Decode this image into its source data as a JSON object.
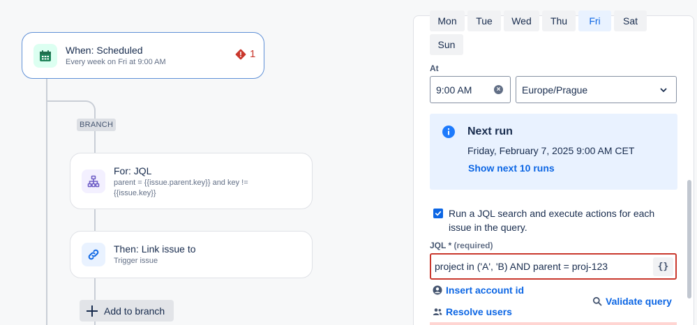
{
  "flow": {
    "trigger": {
      "title": "When: Scheduled",
      "subtitle": "Every week on Fri at 9:00 AM",
      "error_count": "1",
      "icon": "calendar-icon"
    },
    "branch_tag": "BRANCH",
    "for_card": {
      "title": "For: JQL",
      "subtitle": "parent = {{issue.parent.key}} and key != {{issue.key}}",
      "icon": "hierarchy-icon"
    },
    "then_card": {
      "title": "Then: Link issue to",
      "subtitle": "Trigger issue",
      "icon": "link-icon"
    },
    "add_to_branch_label": "Add to branch"
  },
  "panel": {
    "days": [
      {
        "label": "Mon",
        "selected": false
      },
      {
        "label": "Tue",
        "selected": false
      },
      {
        "label": "Wed",
        "selected": false
      },
      {
        "label": "Thu",
        "selected": false
      },
      {
        "label": "Fri",
        "selected": true
      },
      {
        "label": "Sat",
        "selected": false
      },
      {
        "label": "Sun",
        "selected": false
      }
    ],
    "at_label": "At",
    "time_value": "9:00 AM",
    "timezone_value": "Europe/Prague",
    "next_run": {
      "title": "Next run",
      "date": "Friday, February 7, 2025 9:00 AM CET",
      "show_more_label": "Show next 10 runs"
    },
    "jql_checkbox": {
      "checked": true,
      "label": "Run a JQL search and execute actions for each issue in the query."
    },
    "jql_field": {
      "label": "JQL",
      "required_mark": "*",
      "required_text": "(required)",
      "value": "project in ('A', 'B) AND parent = proj-123",
      "braces_label": "{}"
    },
    "insert_account_id_label": "Insert account id",
    "resolve_users_label": "Resolve users",
    "validate_query_label": "Validate query"
  },
  "colors": {
    "accent": "#0c66e4",
    "error": "#c9372c",
    "info_bg": "#e9f2ff",
    "trigger_border": "#5e8fd6"
  }
}
